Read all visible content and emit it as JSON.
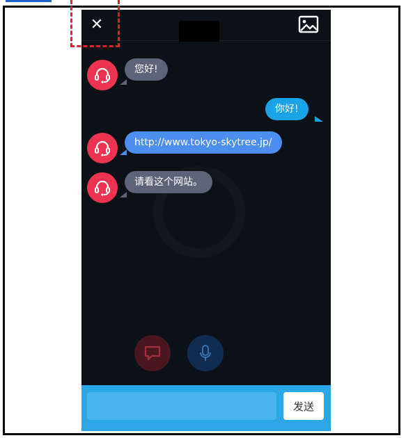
{
  "topbar": {
    "close_glyph": "✕",
    "image_icon": "image-icon"
  },
  "messages": [
    {
      "sender": "agent",
      "text": "您好!",
      "style": "gray"
    },
    {
      "sender": "user",
      "text": "你好!",
      "style": "cyan"
    },
    {
      "sender": "agent",
      "text": "http://www.tokyo-skytree.jp/",
      "style": "blue"
    },
    {
      "sender": "agent",
      "text": "请看这个网站。",
      "style": "gray"
    }
  ],
  "bottom_icons": {
    "chat": "chat-bubble-icon",
    "mic": "microphone-icon"
  },
  "composer": {
    "input_value": "",
    "placeholder": "",
    "send_label": "发送"
  },
  "colors": {
    "background": "#0c1118",
    "avatar": "#ec3450",
    "bubble_gray": "#5e6478",
    "bubble_blue": "#4b8ef0",
    "bubble_cyan": "#1aa3e6",
    "input_bar": "#2ba7e6",
    "highlight": "#d6262c"
  }
}
